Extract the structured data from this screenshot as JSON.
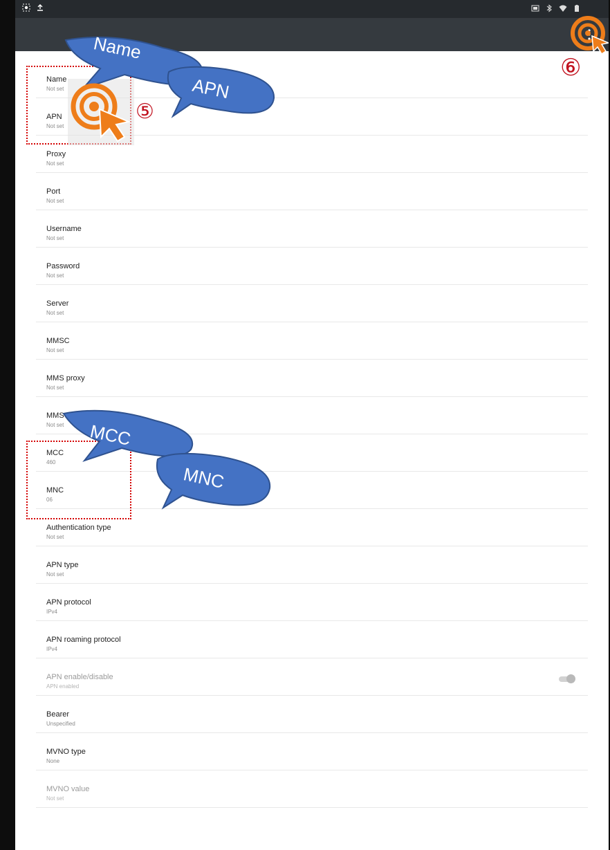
{
  "status_bar": {
    "left_icons": [
      "screen-record-icon",
      "download-icon"
    ],
    "right_icons": [
      "cast-icon",
      "bluetooth-icon",
      "wifi-icon",
      "battery-icon"
    ]
  },
  "toolbar": {
    "title": "",
    "overflow_icon": "more-vert-icon"
  },
  "settings": [
    {
      "title": "Name",
      "value": "Not set"
    },
    {
      "title": "APN",
      "value": "Not set"
    },
    {
      "title": "Proxy",
      "value": "Not set"
    },
    {
      "title": "Port",
      "value": "Not set"
    },
    {
      "title": "Username",
      "value": "Not set"
    },
    {
      "title": "Password",
      "value": "Not set"
    },
    {
      "title": "Server",
      "value": "Not set"
    },
    {
      "title": "MMSC",
      "value": "Not set"
    },
    {
      "title": "MMS proxy",
      "value": "Not set"
    },
    {
      "title": "MMS port",
      "value": "Not set"
    },
    {
      "title": "MCC",
      "value": "460"
    },
    {
      "title": "MNC",
      "value": "06"
    },
    {
      "title": "Authentication type",
      "value": "Not set"
    },
    {
      "title": "APN type",
      "value": "Not set"
    },
    {
      "title": "APN protocol",
      "value": "IPv4"
    },
    {
      "title": "APN roaming protocol",
      "value": "IPv4"
    },
    {
      "title": "APN enable/disable",
      "value": "APN enabled",
      "disabled": true,
      "toggle_on": true
    },
    {
      "title": "Bearer",
      "value": "Unspecified"
    },
    {
      "title": "MVNO type",
      "value": "None"
    },
    {
      "title": "MVNO value",
      "value": "Not set",
      "disabled": true
    }
  ],
  "annotations": {
    "bubble_name": "Name",
    "bubble_apn": "APN",
    "bubble_mcc": "MCC",
    "bubble_mnc": "MNC",
    "step5": "⑤",
    "step6": "⑥",
    "colors": {
      "bubble_fill": "#4472c4",
      "bubble_stroke": "#2f528f",
      "target_orange": "#ee7d1a",
      "dotted_box": "#d40000",
      "step_number": "#c1121f"
    }
  }
}
